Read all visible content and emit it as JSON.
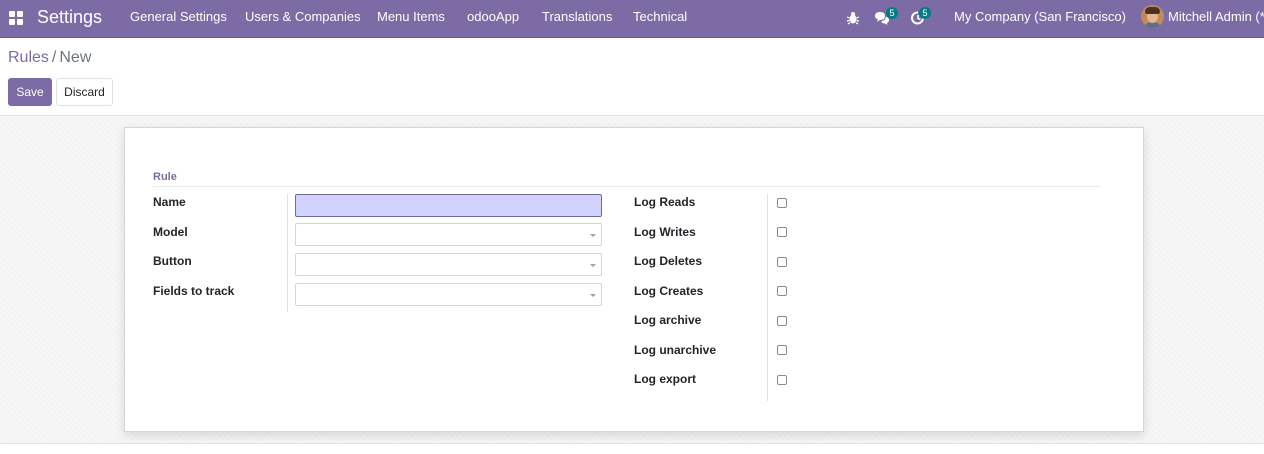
{
  "navbar": {
    "app_title": "Settings",
    "menu": [
      {
        "label": "General Settings"
      },
      {
        "label": "Users & Companies"
      },
      {
        "label": "Menu Items"
      },
      {
        "label": "odooApp"
      },
      {
        "label": "Translations"
      },
      {
        "label": "Technical"
      }
    ],
    "icons": [
      "apps-grid-icon",
      "bug-icon",
      "chat-bubbles-icon",
      "activity-clock-icon"
    ],
    "messages_badge": "5",
    "activities_badge": "5",
    "company": "My Company (San Francisco)",
    "user": "Mitchell Admin (*)",
    "color": "#7c6ba5"
  },
  "breadcrumb": {
    "parent": "Rules",
    "separator": "/",
    "current": "New"
  },
  "buttons": {
    "save": "Save",
    "discard": "Discard"
  },
  "form": {
    "group_title": "Rule",
    "left_fields": [
      {
        "label": "Name",
        "type": "char",
        "value": ""
      },
      {
        "label": "Model",
        "type": "many2one",
        "value": ""
      },
      {
        "label": "Button",
        "type": "many2one",
        "value": ""
      },
      {
        "label": "Fields to track",
        "type": "many2many",
        "value": ""
      }
    ],
    "right_fields": [
      {
        "label": "Log Reads",
        "checked": false
      },
      {
        "label": "Log Writes",
        "checked": false
      },
      {
        "label": "Log Deletes",
        "checked": false
      },
      {
        "label": "Log Creates",
        "checked": false
      },
      {
        "label": "Log archive",
        "checked": false
      },
      {
        "label": "Log unarchive",
        "checked": false
      },
      {
        "label": "Log export",
        "checked": false
      }
    ]
  }
}
